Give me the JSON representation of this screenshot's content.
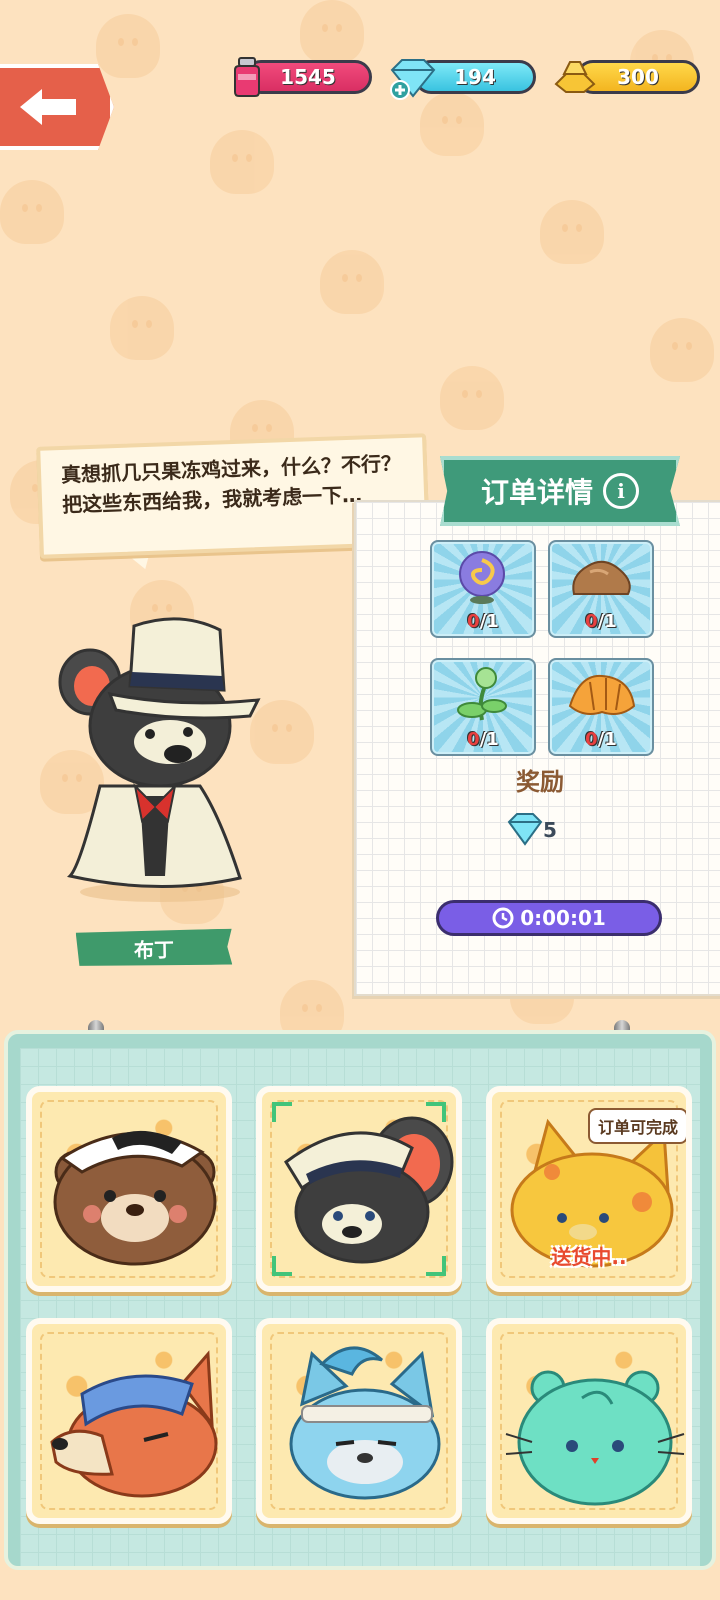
{
  "resources": {
    "ink": "1545",
    "gems": "194",
    "gold": "300"
  },
  "dialog": {
    "text": "真想抓几只果冻鸡过来，什么？不行？把这些东西给我，我就考虑一下…"
  },
  "character": {
    "name": "布丁"
  },
  "order": {
    "title": "订单详情",
    "info_icon": "ⓘ",
    "items": [
      {
        "icon": "swirl-orb-icon",
        "have": "0",
        "need": "/1"
      },
      {
        "icon": "rock-icon",
        "have": "0",
        "need": "/1"
      },
      {
        "icon": "green-plant-icon",
        "have": "0",
        "need": "/1"
      },
      {
        "icon": "croissant-icon",
        "have": "0",
        "need": "/1"
      }
    ],
    "reward_title": "奖励",
    "reward_amount": "5",
    "timer": "0:00:01"
  },
  "roster": {
    "badge": "订单可完成",
    "delivering": "送货中..",
    "slots": [
      "bear",
      "mouse-chef",
      "cat",
      "fox",
      "wolf",
      "hamster"
    ]
  },
  "colors": {
    "background": "#fde2bf",
    "accent_green": "#3f9a7a",
    "ink_bar": "#e03a6c",
    "gem_bar": "#4fd0e8",
    "gold_bar": "#f5bd25",
    "timer": "#7a5ee6"
  }
}
